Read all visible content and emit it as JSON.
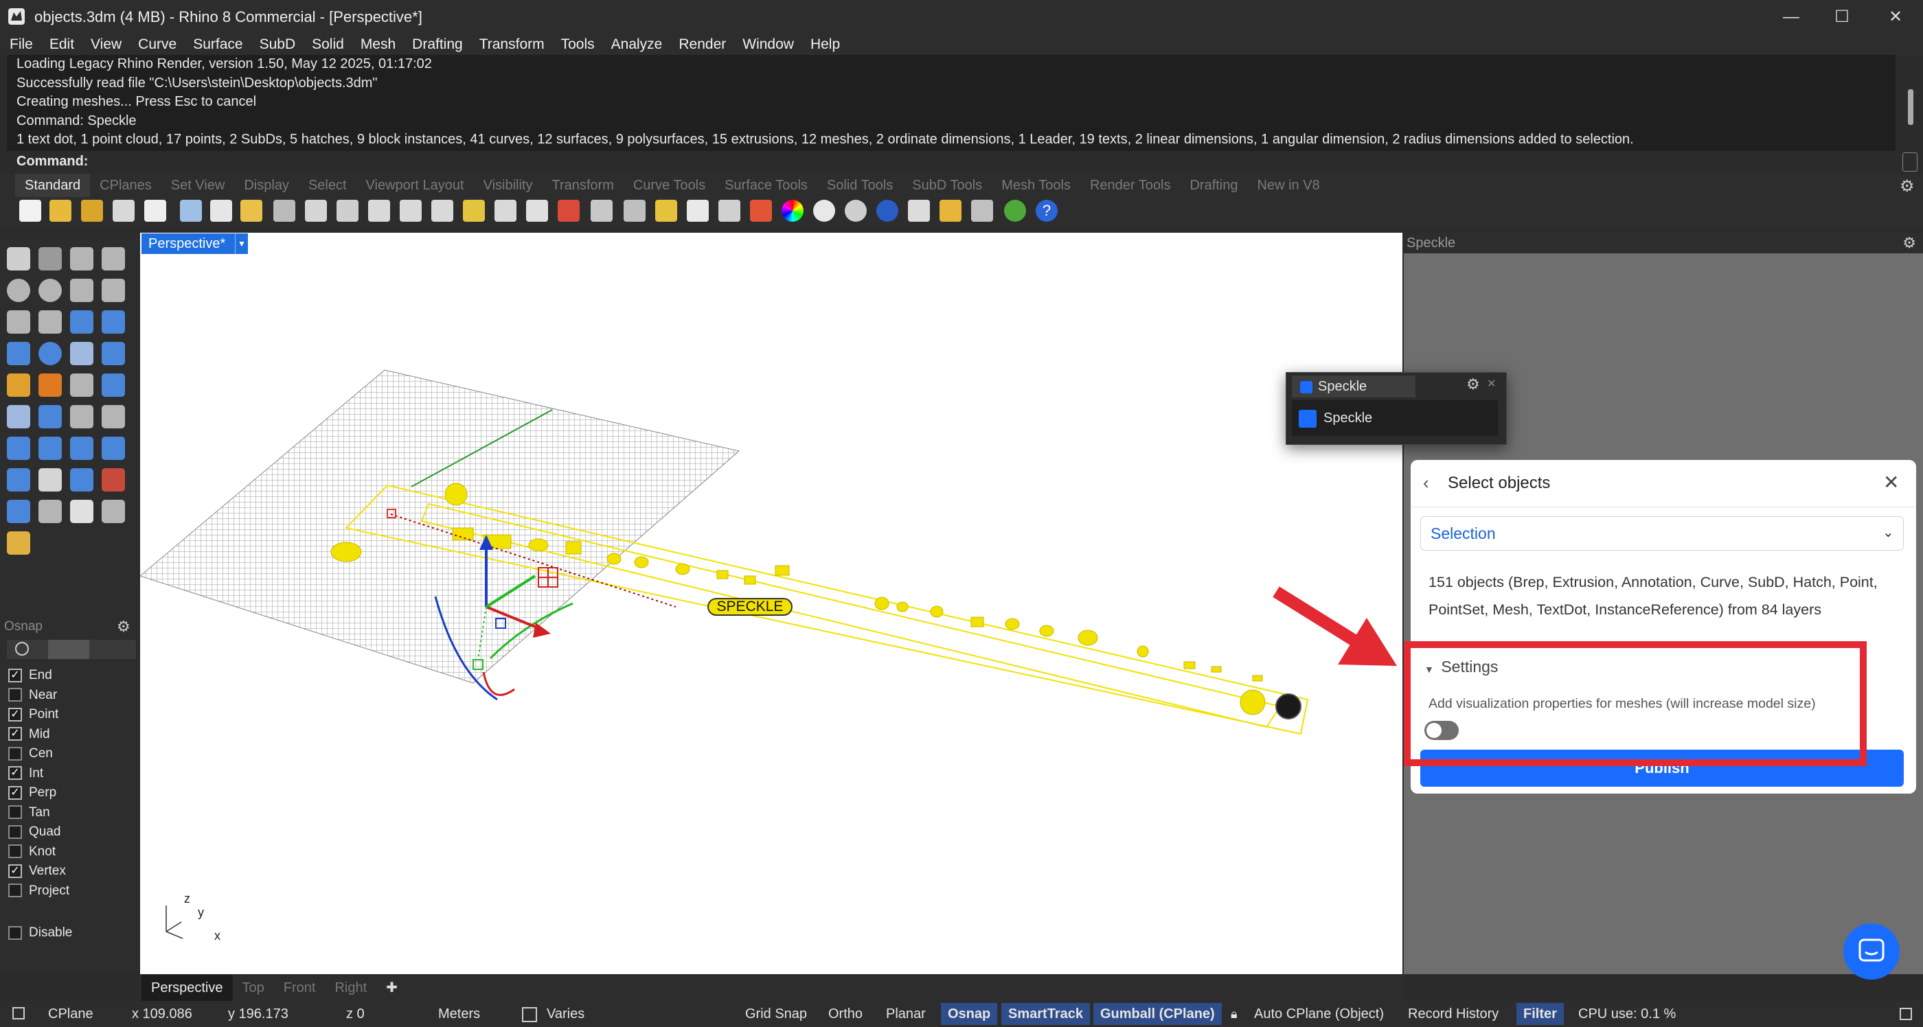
{
  "window": {
    "title": "objects.3dm (4 MB) - Rhino 8 Commercial - [Perspective*]",
    "minimize": "—",
    "maximize": "☐",
    "close": "✕"
  },
  "menu": [
    "File",
    "Edit",
    "View",
    "Curve",
    "Surface",
    "SubD",
    "Solid",
    "Mesh",
    "Drafting",
    "Transform",
    "Tools",
    "Analyze",
    "Render",
    "Window",
    "Help"
  ],
  "history": [
    "Loading Legacy Rhino Render, version 1.50, May 12 2025, 01:17:02",
    "Successfully read file \"C:\\Users\\stein\\Desktop\\objects.3dm\"",
    "Creating meshes... Press Esc to cancel",
    "Command: Speckle",
    "1 text dot, 1 point cloud, 17 points, 2 SubDs, 5 hatches, 9 block instances, 41 curves, 12 surfaces, 9 polysurfaces, 15 extrusions, 12 meshes, 2 ordinate dimensions, 1 Leader, 19 texts, 2 linear dimensions, 1 angular dimension, 2 radius dimensions added to selection."
  ],
  "command_prompt": "Command:",
  "toolbar_tabs": [
    "Standard",
    "CPlanes",
    "Set View",
    "Display",
    "Select",
    "Viewport Layout",
    "Visibility",
    "Transform",
    "Curve Tools",
    "Surface Tools",
    "Solid Tools",
    "SubD Tools",
    "Mesh Tools",
    "Render Tools",
    "Drafting",
    "New in V8"
  ],
  "osnap": {
    "header": "Osnap",
    "items": [
      {
        "label": "End",
        "checked": true
      },
      {
        "label": "Near",
        "checked": false
      },
      {
        "label": "Point",
        "checked": true
      },
      {
        "label": "Mid",
        "checked": true
      },
      {
        "label": "Cen",
        "checked": false
      },
      {
        "label": "Int",
        "checked": true
      },
      {
        "label": "Perp",
        "checked": true
      },
      {
        "label": "Tan",
        "checked": false
      },
      {
        "label": "Quad",
        "checked": false
      },
      {
        "label": "Knot",
        "checked": false
      },
      {
        "label": "Vertex",
        "checked": true
      },
      {
        "label": "Project",
        "checked": false
      }
    ],
    "disable": "Disable"
  },
  "viewport": {
    "active_tab": "Perspective*",
    "label_text": "SPECKLE",
    "axis_z": "z",
    "axis_y": "y",
    "axis_x": "x",
    "tabs": [
      "Perspective",
      "Top",
      "Front",
      "Right"
    ],
    "add": "✚"
  },
  "speckle": {
    "panel_title": "Speckle",
    "popup_tab": "Speckle",
    "popup_item": "Speckle",
    "card_title": "Select objects",
    "selection": "Selection",
    "summary": "151 objects (Brep, Extrusion, Annotation, Curve, SubD, Hatch, Point, PointSet, Mesh, TextDot, InstanceReference) from 84 layers",
    "settings": "Settings",
    "mesh_option": "Add visualization properties for meshes (will increase model size)",
    "toggle_on": false,
    "publish": "Publish",
    "accent": "#1a6cff",
    "highlight": "#e32a33"
  },
  "status": {
    "cplane": "CPlane",
    "x": "x 109.086",
    "y": "y 196.173",
    "z": "z 0",
    "units": "Meters",
    "layer": "Varies",
    "grid_snap": "Grid Snap",
    "ortho": "Ortho",
    "planar": "Planar",
    "osnap": "Osnap",
    "smarttrack": "SmartTrack",
    "gumball": "Gumball (CPlane)",
    "auto_cplane": "Auto CPlane (Object)",
    "record_history": "Record History",
    "filter": "Filter",
    "cpu": "CPU use: 0.1 %"
  }
}
